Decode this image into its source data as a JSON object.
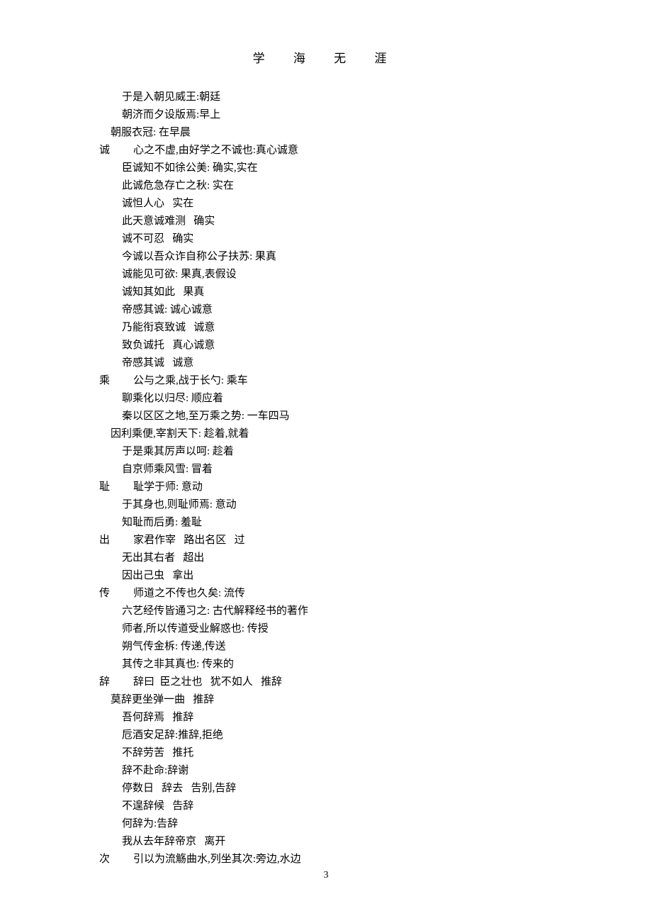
{
  "header": "学 海 无 涯",
  "page_number": "3",
  "lines": [
    {
      "indent": 32,
      "text": "于是入朝见威王:朝廷"
    },
    {
      "indent": 32,
      "text": "朝济而夕设版焉:早上"
    },
    {
      "indent": 16,
      "text": "朝服衣冠: 在早晨"
    },
    {
      "head": "诚",
      "text": "心之不虚,由好学之不诚也:真心诚意"
    },
    {
      "indent": 32,
      "text": "臣诚知不如徐公美: 确实,实在"
    },
    {
      "indent": 32,
      "text": "此诚危急存亡之秋: 实在"
    },
    {
      "indent": 32,
      "text": "诚怛人心   实在"
    },
    {
      "indent": 32,
      "text": "此天意诚难测   确实"
    },
    {
      "indent": 32,
      "text": "诚不可忍   确实"
    },
    {
      "indent": 32,
      "text": "今诚以吾众诈自称公子扶苏: 果真"
    },
    {
      "indent": 32,
      "text": "诚能见可欲: 果真,表假设"
    },
    {
      "indent": 32,
      "text": "诚知其如此   果真"
    },
    {
      "indent": 32,
      "text": "帝感其诚: 诚心诚意"
    },
    {
      "indent": 32,
      "text": "乃能衔哀致诚   诚意"
    },
    {
      "indent": 32,
      "text": "致负诚托   真心诚意"
    },
    {
      "indent": 32,
      "text": "帝感其诚   诚意"
    },
    {
      "head": "乘",
      "text": "公与之乘,战于长勺: 乘车"
    },
    {
      "indent": 32,
      "text": "聊乘化以归尽: 顺应着"
    },
    {
      "indent": 32,
      "text": "秦以区区之地,至万乘之势: 一车四马"
    },
    {
      "indent": 16,
      "text": "因利乘便,宰割天下: 趁着,就着"
    },
    {
      "indent": 32,
      "text": "于是乘其厉声以呵: 趁着"
    },
    {
      "indent": 32,
      "text": "自京师乘风雪: 冒着"
    },
    {
      "head": "耻",
      "text": "耻学于师: 意动"
    },
    {
      "indent": 32,
      "text": "于其身也,则耻师焉: 意动"
    },
    {
      "indent": 32,
      "text": "知耻而后勇: 羞耻"
    },
    {
      "head": "出",
      "text": "家君作宰   路出名区   过"
    },
    {
      "indent": 32,
      "text": "无出其右者   超出"
    },
    {
      "indent": 32,
      "text": "因出己虫   拿出"
    },
    {
      "head": "传",
      "text": "师道之不传也久矣: 流传"
    },
    {
      "indent": 32,
      "text": "六艺经传皆通习之: 古代解释经书的著作"
    },
    {
      "indent": 32,
      "text": "师者,所以传道受业解惑也: 传授"
    },
    {
      "indent": 32,
      "text": "朔气传金柝: 传递,传送"
    },
    {
      "indent": 32,
      "text": "其传之非其真也: 传来的"
    },
    {
      "head": "辞",
      "text": "辞曰  臣之壮也   犹不如人   推辞"
    },
    {
      "indent": 16,
      "text": "莫辞更坐弹一曲   推辞"
    },
    {
      "indent": 32,
      "text": "吾何辞焉   推辞"
    },
    {
      "indent": 32,
      "text": "卮酒安足辞:推辞,拒绝"
    },
    {
      "indent": 32,
      "text": "不辞劳苦   推托"
    },
    {
      "indent": 32,
      "text": "辞不赴命:辞谢"
    },
    {
      "indent": 32,
      "text": "停数日   辞去   告别,告辞"
    },
    {
      "indent": 32,
      "text": "不遑辞候   告辞"
    },
    {
      "indent": 32,
      "text": "何辞为:告辞"
    },
    {
      "indent": 32,
      "text": "我从去年辞帝京   离开"
    },
    {
      "head": "次",
      "text": "引以为流觞曲水,列坐其次:旁边,水边"
    }
  ]
}
